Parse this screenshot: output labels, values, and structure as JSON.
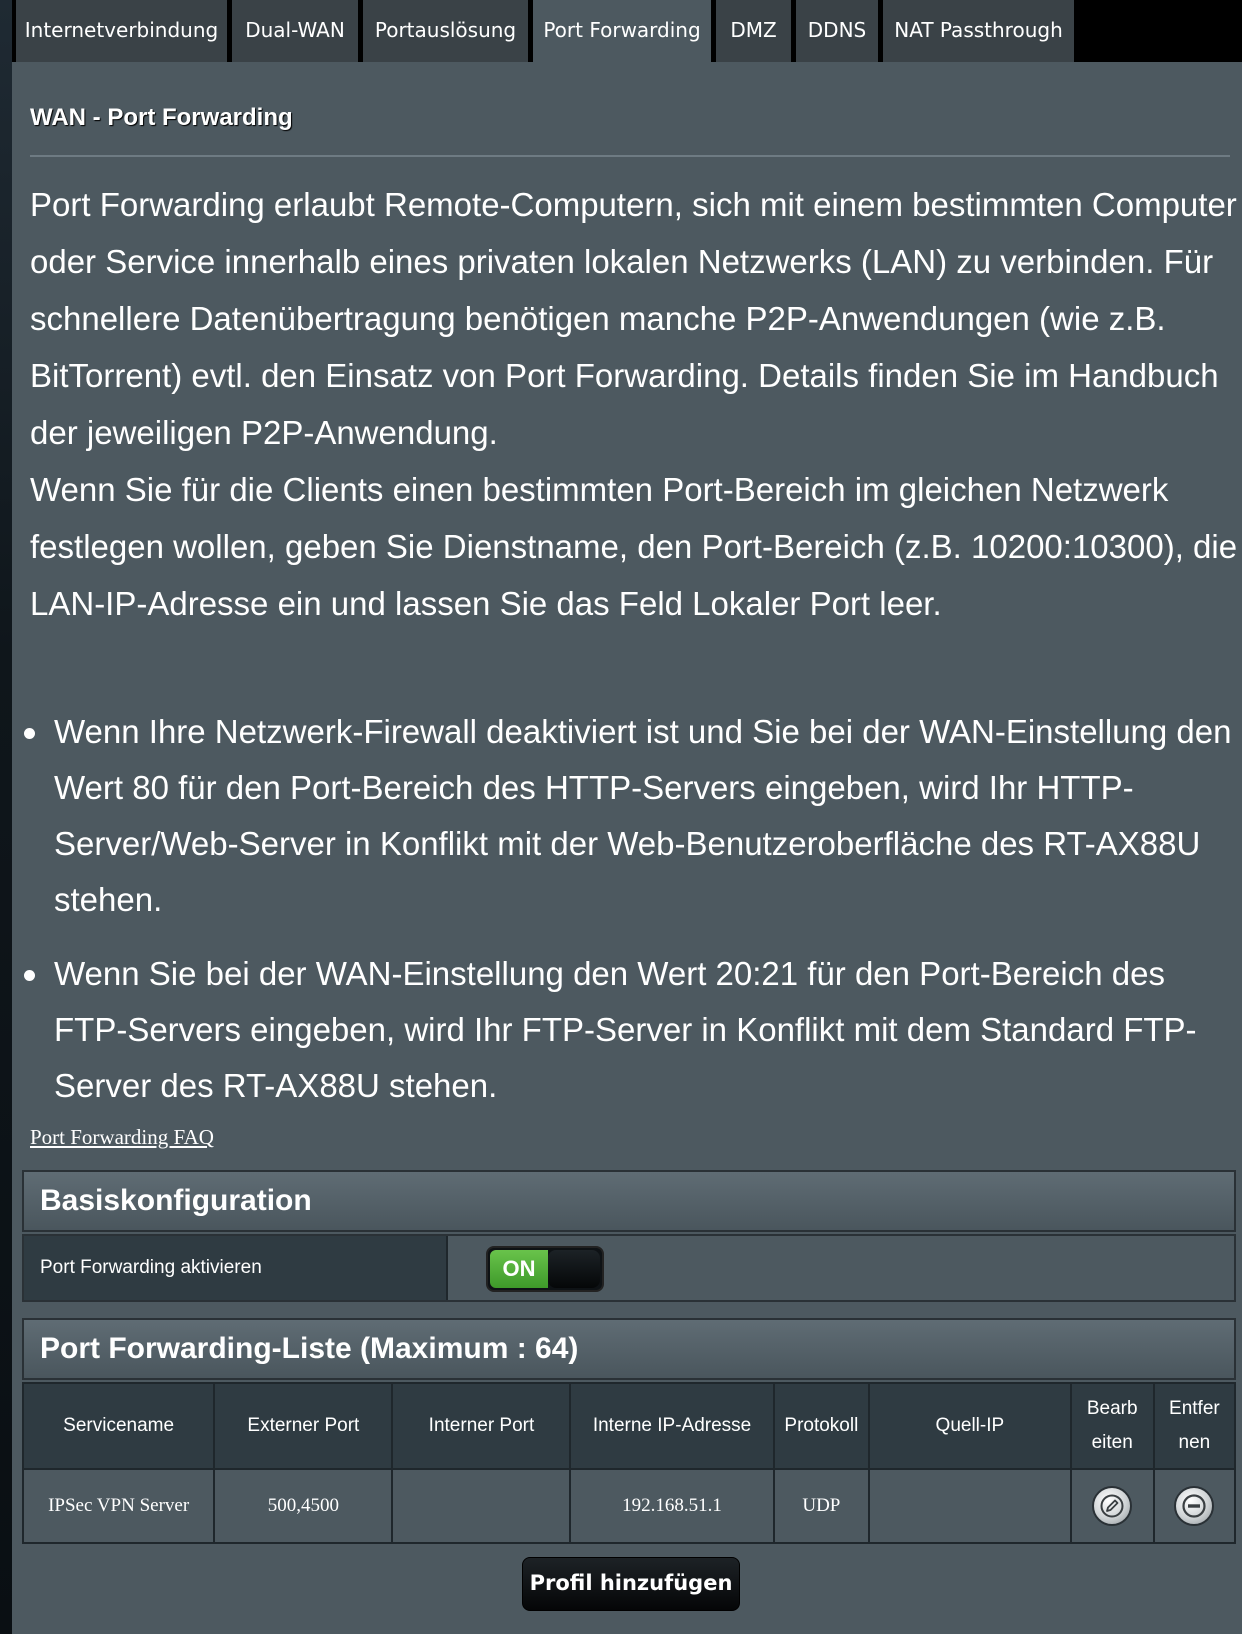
{
  "tabs": [
    {
      "label": "Internetverbindung"
    },
    {
      "label": "Dual-WAN"
    },
    {
      "label": "Portauslösung"
    },
    {
      "label": "Port Forwarding",
      "active": true
    },
    {
      "label": "DMZ"
    },
    {
      "label": "DDNS"
    },
    {
      "label": "NAT Passthrough"
    }
  ],
  "page_title": "WAN - Port Forwarding",
  "intro": {
    "paragraph1": "Port Forwarding erlaubt Remote-Computern, sich mit einem bestimmten Computer oder Service innerhalb eines privaten lokalen Netzwerks (LAN) zu verbinden. Für schnellere Datenübertragung benötigen manche P2P-Anwendungen (wie z.B. BitTorrent) evtl. den Einsatz von Port Forwarding. Details finden Sie im Handbuch der jeweiligen P2P-Anwendung.",
    "paragraph2": "Wenn Sie für die Clients einen bestimmten Port-Bereich im gleichen Netzwerk festlegen wollen, geben Sie Dienstname, den Port-Bereich (z.B. 10200:10300), die LAN-IP-Adresse ein und lassen Sie das Feld Lokaler Port leer."
  },
  "notes": [
    "Wenn Ihre Netzwerk-Firewall deaktiviert ist und Sie bei der WAN-Einstellung den Wert 80 für den Port-Bereich des HTTP-Servers eingeben, wird Ihr HTTP-Server/Web-Server in Konflikt mit der Web-Benutzeroberfläche des RT-AX88U stehen.",
    "Wenn Sie bei der WAN-Einstellung den Wert 20:21 für den Port-Bereich des FTP-Servers eingeben, wird Ihr FTP-Server in Konflikt mit dem Standard FTP-Server des RT-AX88U stehen."
  ],
  "faq_link": "Port Forwarding FAQ",
  "basic_config": {
    "heading": "Basiskonfiguration",
    "enable_label": "Port Forwarding aktivieren",
    "toggle_state": "ON"
  },
  "list": {
    "heading": "Port Forwarding-Liste (Maximum : 64)",
    "columns": {
      "service": "Servicename",
      "external_port": "Externer Port",
      "internal_port": "Interner Port",
      "internal_ip": "Interne IP-Adresse",
      "protocol": "Protokoll",
      "source_ip": "Quell-IP",
      "edit_line1": "Bearb",
      "edit_line2": "eiten",
      "delete_line1": "Entfer",
      "delete_line2": "nen"
    },
    "rows": [
      {
        "service": "IPSec VPN Server",
        "external_port": "500,4500",
        "internal_port": "",
        "internal_ip": "192.168.51.1",
        "protocol": "UDP",
        "source_ip": ""
      }
    ]
  },
  "add_button": "Profil hinzufügen",
  "colors": {
    "page_bg": "#4d5960",
    "tab_bg": "#3a4247",
    "toggle_on": "#4caf3a"
  }
}
